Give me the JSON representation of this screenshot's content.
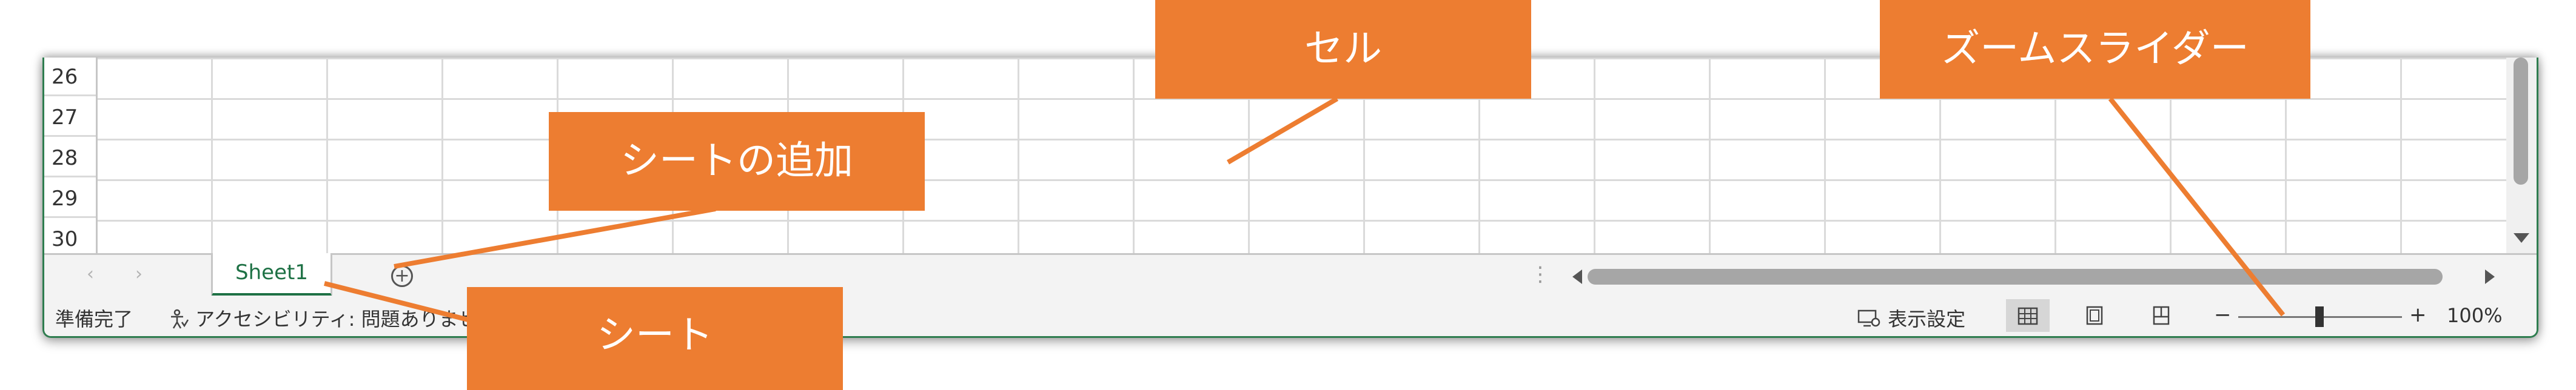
{
  "rows": [
    "26",
    "27",
    "28",
    "29",
    "30"
  ],
  "sheet_tab": "Sheet1",
  "add_sheet_symbol": "+",
  "tab_nav": {
    "prev": "‹",
    "next": "›"
  },
  "status": {
    "ready": "準備完了",
    "accessibility": "アクセシビリティ: 問題ありませ",
    "display_settings": "表示設定",
    "zoom_minus": "−",
    "zoom_plus": "+",
    "zoom_level": "100%"
  },
  "callouts": {
    "cell": "セル",
    "zoom_slider": "ズームスライダー",
    "add_sheet": "シートの追加",
    "sheet": "シート"
  },
  "colors": {
    "accent": "#ed7d31",
    "sheet_tab_text": "#1e7145",
    "window_border": "#2e7d4f"
  }
}
